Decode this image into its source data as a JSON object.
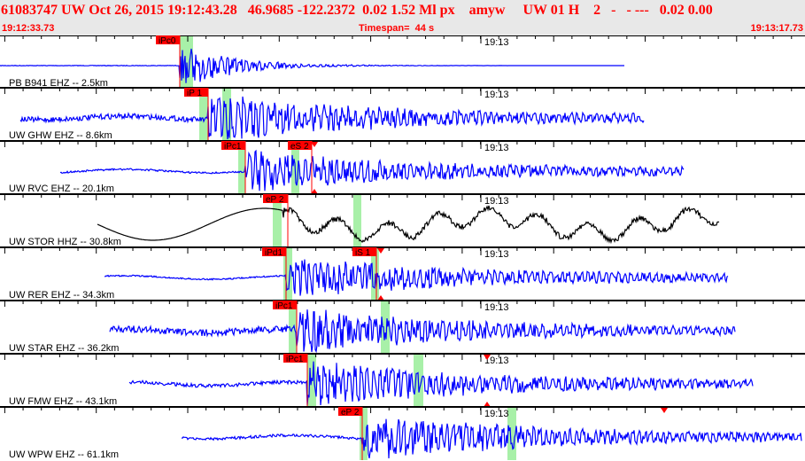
{
  "header": {
    "title": "61083747 UW Oct 26, 2015 19:12:43.28   46.9685 -122.2372  0.02 1.52 Ml px    amyw     UW 01 H    2   -   - ---   0.02 0.00",
    "start_time": "19:12:33.73",
    "timespan": "Timespan=  44 s",
    "end_time": "19:13:17.73"
  },
  "minute_label": "19:13",
  "colors": {
    "pick": "#ff0000",
    "window": "#a8f0a8",
    "trace": "#0000ff",
    "broadband": "#000000"
  },
  "panels": [
    {
      "station": "PB B941 EHZ -- 2.5km",
      "picks": [
        "iPc0"
      ]
    },
    {
      "station": "UW GHW EHZ -- 8.6km",
      "picks": [
        "iP 1"
      ]
    },
    {
      "station": "UW RVC EHZ -- 20.1km",
      "picks": [
        "iPc1",
        "eS 2"
      ]
    },
    {
      "station": "UW STOR HHZ -- 30.8km",
      "picks": [
        "eP 2"
      ]
    },
    {
      "station": "UW RER EHZ -- 34.3km",
      "picks": [
        "iPd1",
        "iS 1"
      ]
    },
    {
      "station": "UW STAR EHZ -- 36.2km",
      "picks": [
        "iPc1"
      ]
    },
    {
      "station": "UW FMW EHZ -- 43.1km",
      "picks": [
        "iPc1"
      ]
    },
    {
      "station": "UW WPW EHZ -- 61.1km",
      "picks": [
        "eP 2"
      ]
    }
  ]
}
